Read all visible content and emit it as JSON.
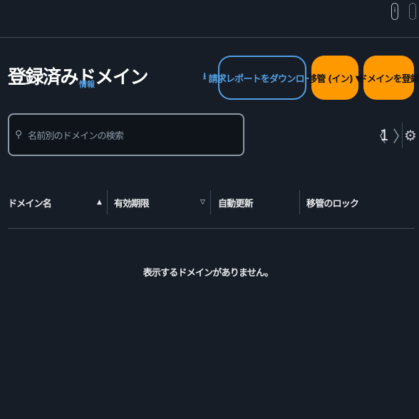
{
  "header": {
    "info_icon": "info-circle-icon",
    "gear_icon": "gear-icon"
  },
  "page": {
    "title": "登録済みドメイン",
    "info_link": "情報"
  },
  "actions": {
    "download_label": "請求レポートをダウンロード",
    "download_icon": "download-icon",
    "transfer_label": "移管 (イン) ▼",
    "register_label": "ドメインを登録"
  },
  "search": {
    "placeholder": "名前別のドメインの検索",
    "icon": "search-icon"
  },
  "pagination": {
    "prev": "〈",
    "current_page": "1",
    "next": "〉",
    "settings_icon": "settings-icon"
  },
  "table": {
    "columns": [
      "ドメイン名",
      "有効期限",
      "自動更新",
      "移管のロック"
    ],
    "sort_asc": "▲",
    "sort_desc": "▽",
    "empty_message": "表示するドメインがありません。"
  }
}
